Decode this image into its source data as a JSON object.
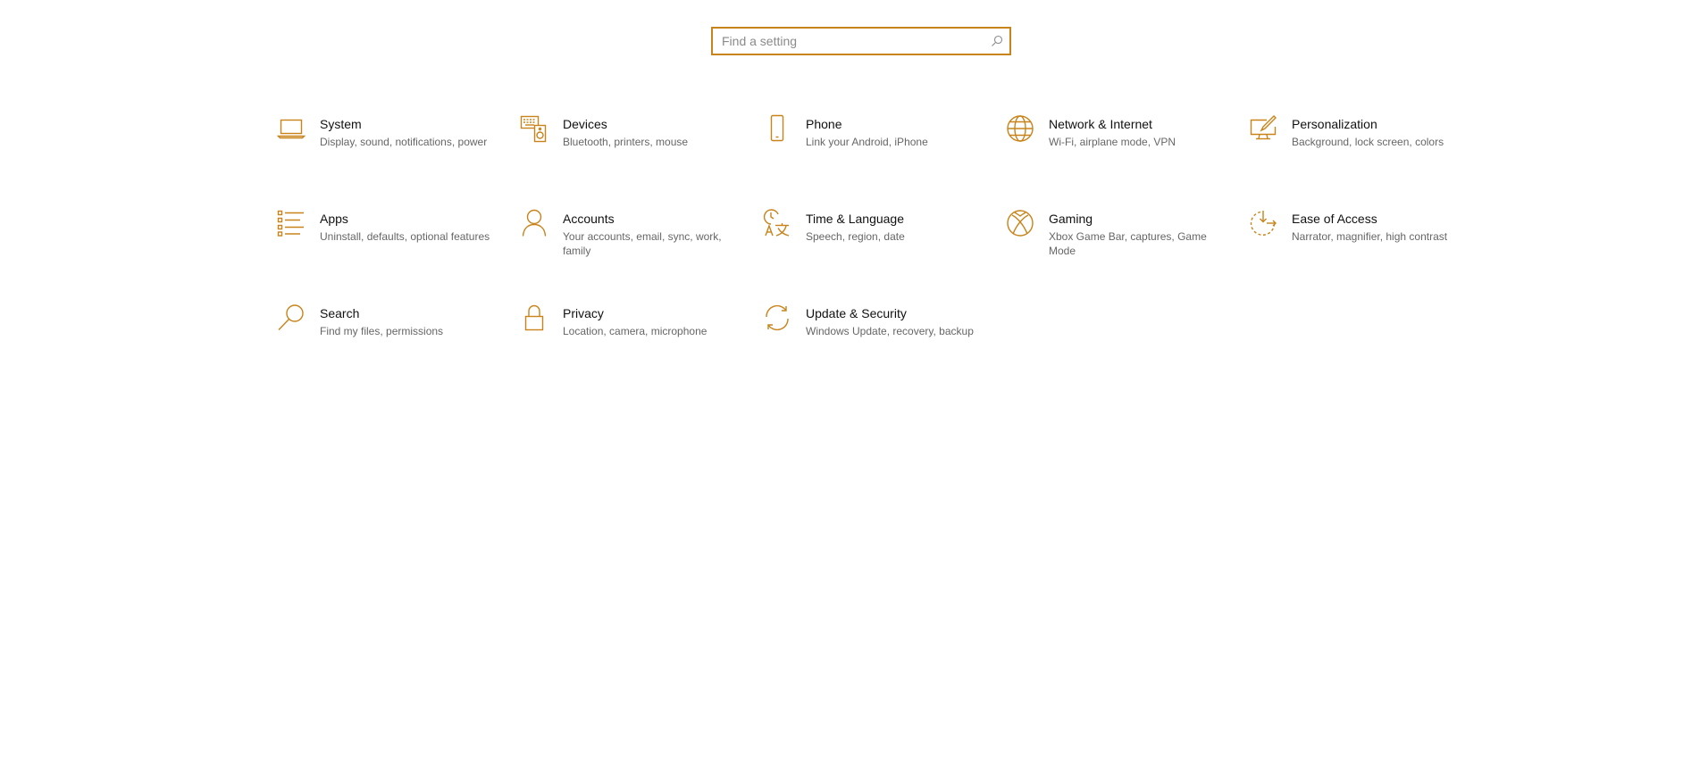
{
  "search": {
    "placeholder": "Find a setting",
    "value": ""
  },
  "colors": {
    "accent": "#c8831a",
    "title": "#111111",
    "description": "#666666",
    "background": "#ffffff"
  },
  "tiles": [
    {
      "icon": "laptop-icon",
      "title": "System",
      "description": "Display, sound, notifications, power"
    },
    {
      "icon": "devices-icon",
      "title": "Devices",
      "description": "Bluetooth, printers, mouse"
    },
    {
      "icon": "phone-icon",
      "title": "Phone",
      "description": "Link your Android, iPhone"
    },
    {
      "icon": "globe-icon",
      "title": "Network & Internet",
      "description": "Wi-Fi, airplane mode, VPN"
    },
    {
      "icon": "personalization-icon",
      "title": "Personalization",
      "description": "Background, lock screen, colors"
    },
    {
      "icon": "apps-list-icon",
      "title": "Apps",
      "description": "Uninstall, defaults, optional features"
    },
    {
      "icon": "person-icon",
      "title": "Accounts",
      "description": "Your accounts, email, sync, work, family"
    },
    {
      "icon": "time-language-icon",
      "title": "Time & Language",
      "description": "Speech, region, date"
    },
    {
      "icon": "xbox-icon",
      "title": "Gaming",
      "description": "Xbox Game Bar, captures, Game Mode"
    },
    {
      "icon": "ease-of-access-icon",
      "title": "Ease of Access",
      "description": "Narrator, magnifier, high contrast"
    },
    {
      "icon": "search-icon",
      "title": "Search",
      "description": "Find my files, permissions"
    },
    {
      "icon": "lock-icon",
      "title": "Privacy",
      "description": "Location, camera, microphone"
    },
    {
      "icon": "sync-icon",
      "title": "Update & Security",
      "description": "Windows Update, recovery, backup"
    }
  ]
}
